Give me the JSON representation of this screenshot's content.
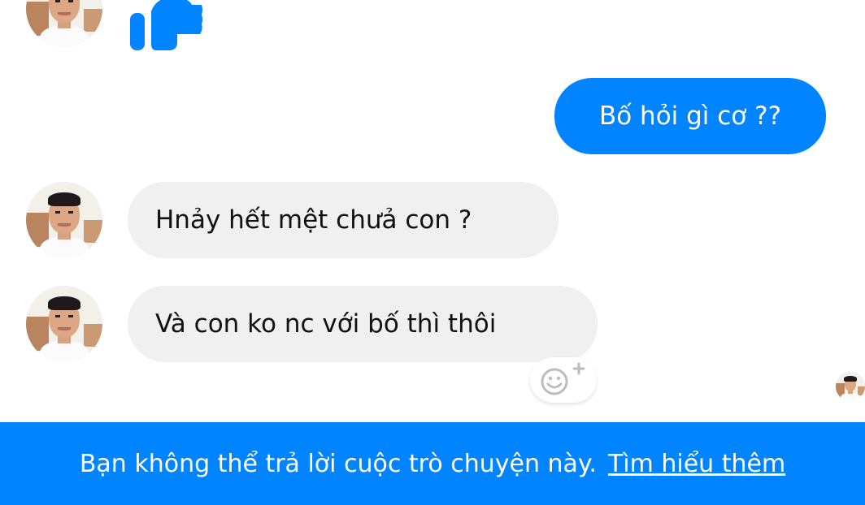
{
  "messages": [
    {
      "direction": "outgoing",
      "text": "Bố hỏi gì cơ ??"
    },
    {
      "direction": "incoming",
      "text": "Hnảy hết mệt chưả con ?"
    },
    {
      "direction": "incoming",
      "text": "Và con ko nc với bố thì thôi"
    }
  ],
  "reaction": {
    "icon": "thumbs-up-icon"
  },
  "react_button": {
    "icon": "smiley-add-icon"
  },
  "footer": {
    "notice": "Bạn không thể trả lời cuộc trò chuyện này.",
    "link": "Tìm hiểu thêm"
  },
  "colors": {
    "accent": "#0084ff",
    "incoming_bubble": "#f0f0f0",
    "background": "#ffffff"
  }
}
